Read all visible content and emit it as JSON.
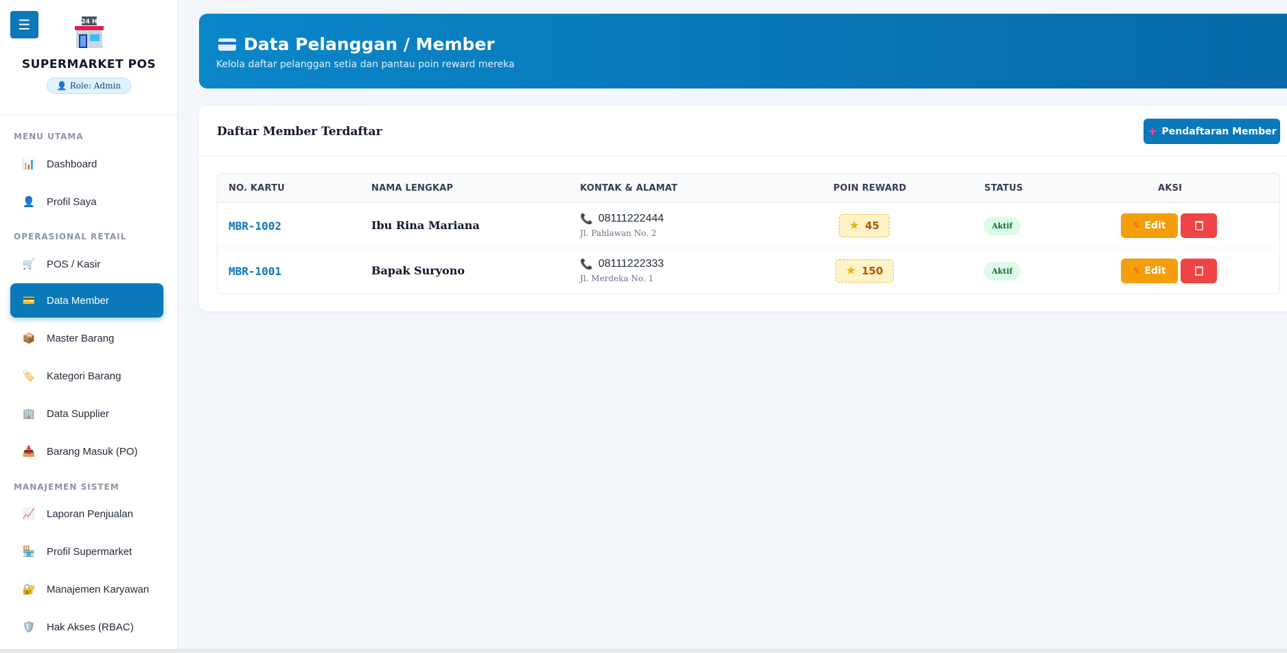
{
  "app": {
    "brand_title": "SUPERMARKET POS",
    "logo_text": "24 H",
    "role": "Role: Admin",
    "menu_icon": "hamburger-icon"
  },
  "sidebar": {
    "sections": [
      {
        "title": "MENU UTAMA"
      },
      {
        "title": "OPERASIONAL RETAIL"
      },
      {
        "title": "MANAJEMEN SISTEM"
      }
    ],
    "items": [
      {
        "label": "Dashboard",
        "icon": "bar-chart-icon"
      },
      {
        "label": "Profil Saya",
        "icon": "user-icon"
      },
      {
        "label": "POS / Kasir",
        "icon": "cart-icon"
      },
      {
        "label": "Data Member",
        "icon": "credit-card-icon",
        "active": true
      },
      {
        "label": "Master Barang",
        "icon": "package-icon"
      },
      {
        "label": "Kategori Barang",
        "icon": "tag-icon"
      },
      {
        "label": "Data Supplier",
        "icon": "building-icon"
      },
      {
        "label": "Barang Masuk (PO)",
        "icon": "inbox-icon"
      },
      {
        "label": "Laporan Penjualan",
        "icon": "line-chart-icon"
      },
      {
        "label": "Profil Supermarket",
        "icon": "store-icon"
      },
      {
        "label": "Manajemen Karyawan",
        "icon": "lock-icon"
      },
      {
        "label": "Hak Akses (RBAC)",
        "icon": "shield-icon"
      }
    ]
  },
  "header": {
    "title": "Data Pelanggan / Member",
    "subtitle": "Kelola daftar pelanggan setia dan pantau poin reward mereka"
  },
  "members_card": {
    "title": "Daftar Member Terdaftar",
    "add_button": "Pendaftaran Member",
    "columns": [
      "NO. KARTU",
      "NAMA LENGKAP",
      "KONTAK & ALAMAT",
      "POIN REWARD",
      "STATUS",
      "AKSI"
    ],
    "rows": [
      {
        "card_no": "MBR-1002",
        "name": "Ibu Rina Mariana",
        "phone": "08111222444",
        "address": "Jl. Pahlawan No. 2",
        "points": "45",
        "status": "Aktif",
        "edit": "Edit"
      },
      {
        "card_no": "MBR-1001",
        "name": "Bapak Suryono",
        "phone": "08111222333",
        "address": "Jl. Merdeka No. 1",
        "points": "150",
        "status": "Aktif",
        "edit": "Edit"
      }
    ]
  },
  "colors": {
    "primary": "#0b78b9",
    "warning": "#f59e0b",
    "danger": "#ef4444",
    "success_bg": "#dcfce7"
  }
}
